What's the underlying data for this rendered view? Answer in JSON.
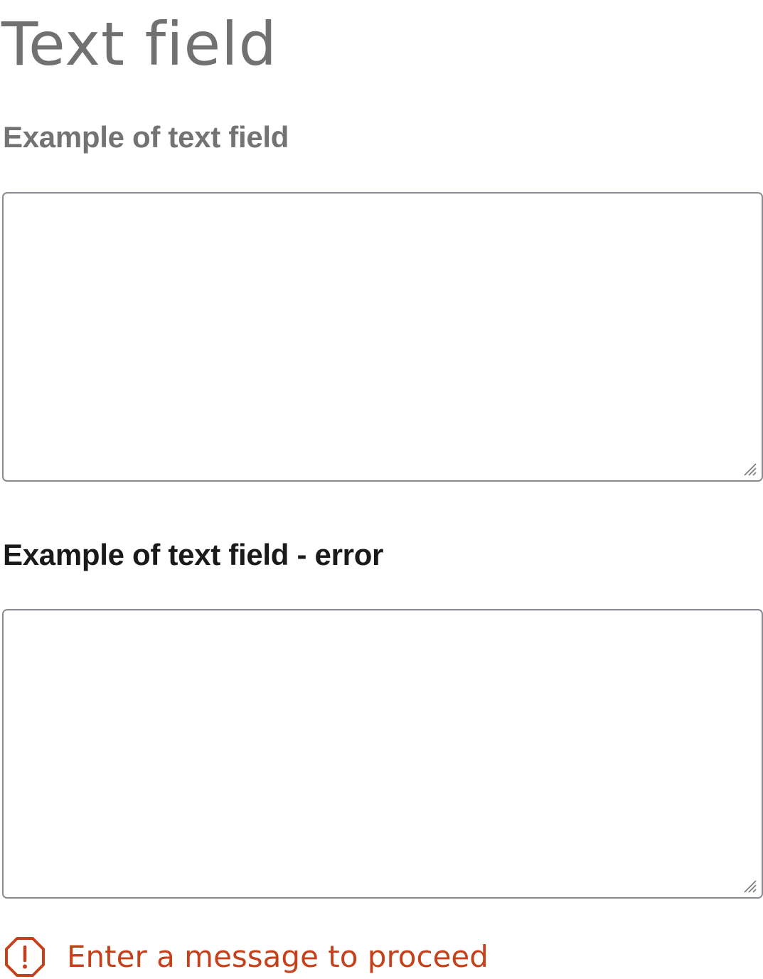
{
  "page": {
    "title": "Text field"
  },
  "fields": [
    {
      "label": "Example of text field",
      "value": "",
      "placeholder": ""
    },
    {
      "label": "Example of text field - error",
      "value": "",
      "placeholder": ""
    }
  ],
  "error": {
    "icon": "exclamation-octagon-icon",
    "message": "Enter a message to proceed",
    "color": "#c5411b"
  },
  "colors": {
    "title": "#717171",
    "label_default": "#737373",
    "label_error": "#1a1a1a",
    "field_border": "#8a8a90",
    "error": "#c5411b"
  }
}
